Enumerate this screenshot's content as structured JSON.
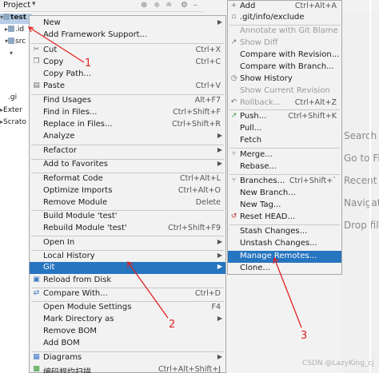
{
  "tool_window": {
    "title": "Project",
    "chevron": "▾",
    "toolbar_icons": [
      "gear-plus-icon",
      "collapse-icon",
      "expand-icon",
      "settings-icon",
      "minimize-icon"
    ],
    "tree": [
      {
        "label": "test",
        "selected": true
      },
      {
        "label": ".id",
        "selected": false
      },
      {
        "label": "src",
        "selected": false
      },
      {
        "label": "",
        "selected": false
      },
      {
        "label": "",
        "selected": false
      },
      {
        "label": "",
        "selected": false
      },
      {
        "label": ".gi",
        "selected": false
      },
      {
        "label": "Exter",
        "selected": false
      },
      {
        "label": "Scrato",
        "selected": false
      }
    ]
  },
  "editor_hints": [
    "Search E",
    "Go to Fi",
    "Recent F",
    "Navigati",
    "Drop file"
  ],
  "context_menu": {
    "items": [
      {
        "label": "New",
        "shortcut": "",
        "submenu": true,
        "icon": ""
      },
      {
        "label": "Add Framework Support...",
        "shortcut": "",
        "submenu": false,
        "icon": ""
      },
      {
        "label": "Cut",
        "shortcut": "Ctrl+X",
        "submenu": false,
        "icon": "scissors-icon"
      },
      {
        "label": "Copy",
        "shortcut": "Ctrl+C",
        "submenu": false,
        "icon": "copy-icon"
      },
      {
        "label": "Copy Path...",
        "shortcut": "",
        "submenu": false,
        "icon": ""
      },
      {
        "label": "Paste",
        "shortcut": "Ctrl+V",
        "submenu": false,
        "icon": "paste-icon"
      },
      {
        "label": "Find Usages",
        "shortcut": "Alt+F7",
        "submenu": false,
        "icon": ""
      },
      {
        "label": "Find in Files...",
        "shortcut": "Ctrl+Shift+F",
        "submenu": false,
        "icon": ""
      },
      {
        "label": "Replace in Files...",
        "shortcut": "Ctrl+Shift+R",
        "submenu": false,
        "icon": ""
      },
      {
        "label": "Analyze",
        "shortcut": "",
        "submenu": true,
        "icon": ""
      },
      {
        "label": "Refactor",
        "shortcut": "",
        "submenu": true,
        "icon": ""
      },
      {
        "label": "Add to Favorites",
        "shortcut": "",
        "submenu": true,
        "icon": ""
      },
      {
        "label": "Reformat Code",
        "shortcut": "Ctrl+Alt+L",
        "submenu": false,
        "icon": ""
      },
      {
        "label": "Optimize Imports",
        "shortcut": "Ctrl+Alt+O",
        "submenu": false,
        "icon": ""
      },
      {
        "label": "Remove Module",
        "shortcut": "Delete",
        "submenu": false,
        "icon": ""
      },
      {
        "label": "Build Module 'test'",
        "shortcut": "",
        "submenu": false,
        "icon": ""
      },
      {
        "label": "Rebuild Module 'test'",
        "shortcut": "Ctrl+Shift+F9",
        "submenu": false,
        "icon": ""
      },
      {
        "label": "Open In",
        "shortcut": "",
        "submenu": true,
        "icon": ""
      },
      {
        "label": "Local History",
        "shortcut": "",
        "submenu": true,
        "icon": ""
      },
      {
        "label": "Git",
        "shortcut": "",
        "submenu": true,
        "icon": "",
        "active": true
      },
      {
        "label": "Reload from Disk",
        "shortcut": "",
        "submenu": false,
        "icon": "reload-icon"
      },
      {
        "label": "Compare With...",
        "shortcut": "Ctrl+D",
        "submenu": false,
        "icon": "compare-icon"
      },
      {
        "label": "Open Module Settings",
        "shortcut": "F4",
        "submenu": false,
        "icon": ""
      },
      {
        "label": "Mark Directory as",
        "shortcut": "",
        "submenu": true,
        "icon": ""
      },
      {
        "label": "Remove BOM",
        "shortcut": "",
        "submenu": false,
        "icon": ""
      },
      {
        "label": "Add BOM",
        "shortcut": "",
        "submenu": false,
        "icon": ""
      },
      {
        "label": "Diagrams",
        "shortcut": "",
        "submenu": true,
        "icon": "diagram-icon"
      },
      {
        "label": "编码规约扫描",
        "shortcut": "Ctrl+Alt+Shift+J",
        "submenu": false,
        "icon": "scan-icon"
      }
    ]
  },
  "git_submenu": {
    "items": [
      {
        "label": "Add",
        "shortcut": "Ctrl+Alt+A",
        "icon": "plus-icon",
        "disabled": false
      },
      {
        "label": ".git/info/exclude",
        "shortcut": "",
        "icon": "git-file-icon",
        "disabled": false
      },
      {
        "label": "Annotate with Git Blame",
        "shortcut": "",
        "icon": "",
        "disabled": true
      },
      {
        "label": "Show Diff",
        "shortcut": "",
        "icon": "diff-icon",
        "disabled": true
      },
      {
        "label": "Compare with Revision...",
        "shortcut": "",
        "icon": "",
        "disabled": false
      },
      {
        "label": "Compare with Branch...",
        "shortcut": "",
        "icon": "",
        "disabled": false
      },
      {
        "label": "Show History",
        "shortcut": "",
        "icon": "clock-icon",
        "disabled": false
      },
      {
        "label": "Show Current Revision",
        "shortcut": "",
        "icon": "",
        "disabled": true
      },
      {
        "label": "Rollback...",
        "shortcut": "Ctrl+Alt+Z",
        "icon": "rollback-icon",
        "disabled": true
      },
      {
        "label": "Push...",
        "shortcut": "Ctrl+Shift+K",
        "icon": "push-icon",
        "disabled": false
      },
      {
        "label": "Pull...",
        "shortcut": "",
        "icon": "",
        "disabled": false
      },
      {
        "label": "Fetch",
        "shortcut": "",
        "icon": "",
        "disabled": false
      },
      {
        "label": "Merge...",
        "shortcut": "",
        "icon": "merge-icon",
        "disabled": false
      },
      {
        "label": "Rebase...",
        "shortcut": "",
        "icon": "",
        "disabled": false
      },
      {
        "label": "Branches...",
        "shortcut": "Ctrl+Shift+`",
        "icon": "branch-icon",
        "disabled": false
      },
      {
        "label": "New Branch...",
        "shortcut": "",
        "icon": "",
        "disabled": false
      },
      {
        "label": "New Tag...",
        "shortcut": "",
        "icon": "",
        "disabled": false
      },
      {
        "label": "Reset HEAD...",
        "shortcut": "",
        "icon": "reset-icon",
        "disabled": false
      },
      {
        "label": "Stash Changes...",
        "shortcut": "",
        "icon": "",
        "disabled": false
      },
      {
        "label": "Unstash Changes...",
        "shortcut": "",
        "icon": "",
        "disabled": false
      },
      {
        "label": "Manage Remotes...",
        "shortcut": "",
        "icon": "",
        "disabled": false,
        "active": true
      },
      {
        "label": "Clone...",
        "shortcut": "",
        "icon": "",
        "disabled": false
      }
    ]
  },
  "annotations": {
    "color": "#e02020",
    "labels": [
      "1",
      "2",
      "3"
    ]
  },
  "watermark": "CSDN @LazyKing_cj",
  "colors": {
    "menu_bg": "#f2f2f2",
    "highlight": "#2675bf",
    "annotation": "#e02020"
  }
}
